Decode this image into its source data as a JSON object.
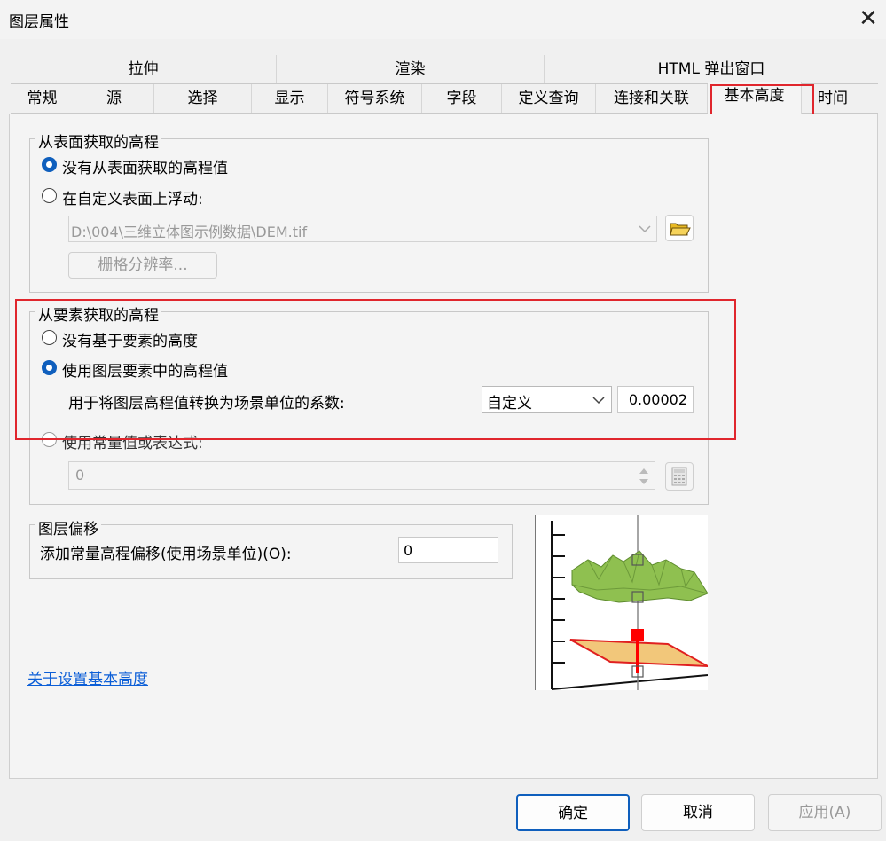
{
  "window": {
    "title": "图层属性",
    "close_glyph": "✕"
  },
  "tabs_row1": [
    "拉伸",
    "渲染",
    "HTML 弹出窗口"
  ],
  "tabs_row2": [
    "常规",
    "源",
    "选择",
    "显示",
    "符号系统",
    "字段",
    "定义查询",
    "连接和关联",
    "基本高度",
    "时间"
  ],
  "active_tab": "基本高度",
  "surface_group": {
    "legend": "从表面获取的高程",
    "option_none": "没有从表面获取的高程值",
    "option_custom": "在自定义表面上浮动:",
    "surface_path": "D:\\004\\三维立体图示例数据\\DEM.tif",
    "raster_resolution_button": "栅格分辨率..."
  },
  "feature_group": {
    "legend": "从要素获取的高程",
    "option_none": "没有基于要素的高度",
    "option_layer_values": "使用图层要素中的高程值",
    "factor_label": "用于将图层高程值转换为场景单位的系数:",
    "factor_unit": "自定义",
    "factor_value": "0.00002",
    "option_expression": "使用常量值或表达式:",
    "expression_value": "0"
  },
  "offset_group": {
    "legend": "图层偏移",
    "label": "添加常量高程偏移(使用场景单位)(O):",
    "value": "0"
  },
  "help_link": "关于设置基本高度",
  "buttons": {
    "ok": "确定",
    "cancel": "取消",
    "apply": "应用(A)"
  },
  "icons": [
    "close-icon",
    "folder-open-icon",
    "chevron-down-icon",
    "spin-arrows-icon",
    "calculator-icon"
  ],
  "colors": {
    "accent": "#0f5fbd",
    "highlight_red": "#e0262d",
    "link": "#0b5ed7"
  }
}
